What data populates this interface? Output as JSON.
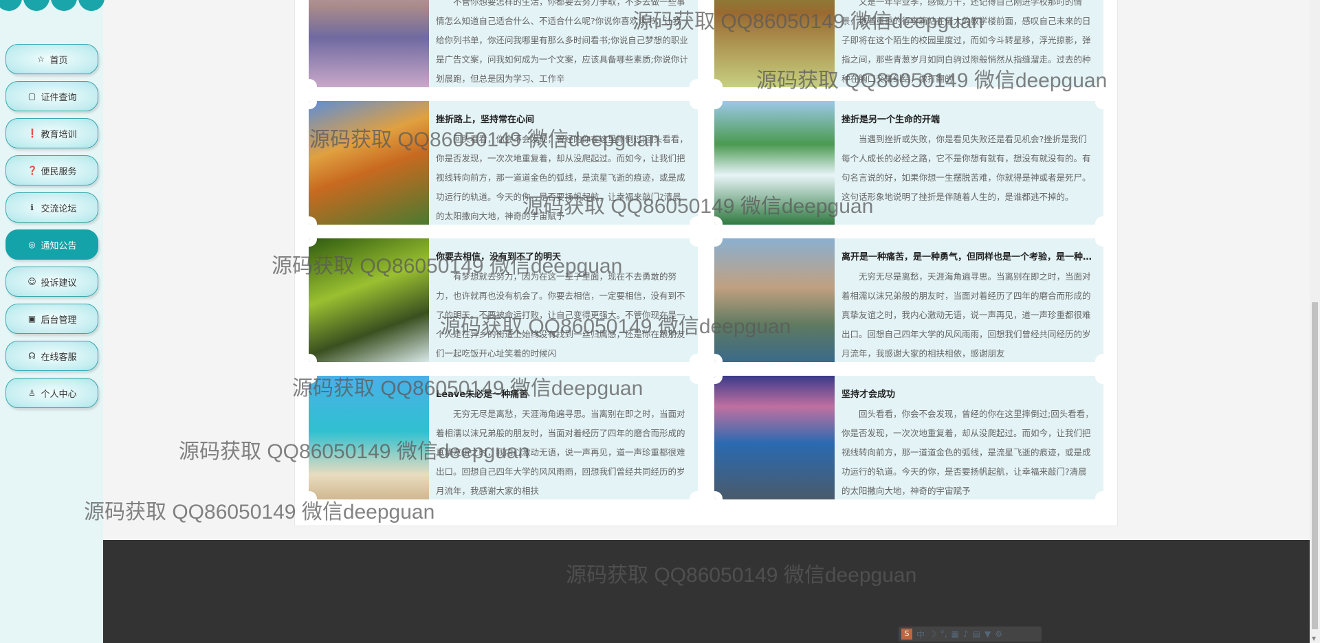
{
  "sidebar": {
    "accent": "#14a3a8",
    "items": [
      {
        "label": "首页",
        "icon": "star-icon",
        "glyph": "☆"
      },
      {
        "label": "证件查询",
        "icon": "bag-icon",
        "glyph": "▢"
      },
      {
        "label": "教育培训",
        "icon": "exclamation-icon",
        "glyph": "❗"
      },
      {
        "label": "便民服务",
        "icon": "question-icon",
        "glyph": "❓"
      },
      {
        "label": "交流论坛",
        "icon": "info-icon",
        "glyph": "ℹ"
      },
      {
        "label": "通知公告",
        "icon": "target-icon",
        "glyph": "◎",
        "active": true
      },
      {
        "label": "投诉建议",
        "icon": "smile-icon",
        "glyph": "☺"
      },
      {
        "label": "后台管理",
        "icon": "briefcase-icon",
        "glyph": "▣"
      },
      {
        "label": "在线客服",
        "icon": "headset-icon",
        "glyph": "☊"
      },
      {
        "label": "个人中心",
        "icon": "user-icon",
        "glyph": "♙"
      }
    ]
  },
  "cards": [
    {
      "title": "",
      "text": "不管你想要怎样的生活，你都要去努力争取，不多去做一些事情怎么知道自己适合什么、不适合什么呢?你说你喜欢读书，让我给你列书单，你还问我哪里有那么多时间看书;你说自己梦想的职业是广告文案，问我如何成为一个文案，应该具备哪些素质;你说你计划晨跑，但总是因为学习、工作辛"
    },
    {
      "title": "",
      "text": "又是一年毕业季，感慨万千，还记得自己刚进学校那时的情景，拖着重重的行李箱站在偌大的教学楼前面，感叹自己未来的日子即将在这个陌生的校园里度过，而如今斗转星移，浮光掠影，弹指之间，那些青葱岁月如同白驹过隙般悄然从指缝溜走。过去的种种在胸口交集纠结，像打翻的"
    },
    {
      "title": "挫折路上，坚持常在心间",
      "text": "回头看看，你会不会发现，曾经的你在这里摔倒过;回头看看，你是否发现，一次次地重复着，却从没爬起过。而如今，让我们把视线转向前方，那一道道金色的弧线，是流星飞逝的痕迹，或是成功运行的轨道。今天的你，是否要扬帆起航，让幸福来敲门?清晨的太阳撒向大地，神奇的宇宙赋予"
    },
    {
      "title": "挫折是另一个生命的开端",
      "text": "当遇到挫折或失败，你是看见失败还是看见机会?挫折是我们每个人成长的必经之路，它不是你想有就有，想没有就没有的。有句名言说的好，如果你想一生摆脱苦难，你就得是神或者是死尸。这句话形象地说明了挫折是伴随着人生的，是谁都逃不掉的。"
    },
    {
      "title": "你要去相信，没有到不了的明天",
      "text": "有梦想就去努力，因为在这一辈子里面，现在不去勇敢的努力，也许就再也没有机会了。你要去相信，一定要相信，没有到不了的明天。不要被命运打败，让自己变得更强大。不管你现在是一个人走在异乡的街道上始终没有找到一丝归属感，还是你在跟朋友们一起吃饭开心址笑着的时候闪"
    },
    {
      "title": "离开是一种痛苦，是一种勇气，但同样也是一个考验，是一种成长",
      "text": "无穷无尽是离愁，天涯海角遍寻思。当离别在即之时，当面对着相濡以沫兄弟般的朋友时，当面对着经历了四年的磨合而形成的真挚友谊之时，我内心激动无语，说一声再见，道一声珍重都很难出口。回想自己四年大学的风风雨雨，回想我们曾经共同经历的岁月流年，我感谢大家的相扶相依，感谢朋友"
    },
    {
      "title": "Leave未必是一种痛苦",
      "text": "无穷无尽是离愁，天涯海角遍寻思。当离别在即之时，当面对着相濡以沫兄弟般的朋友时，当面对着经历了四年的磨合而形成的真挚友谊之时，我内心激动无语，说一声再见，道一声珍重都很难出口。回想自己四年大学的风风雨雨，回想我们曾经共同经历的岁月流年，我感谢大家的相扶"
    },
    {
      "title": "坚持才会成功",
      "text": "回头看看，你会不会发现，曾经的你在这里摔倒过;回头看看，你是否发现，一次次地重复着，却从没爬起过。而如今，让我们把视线转向前方，那一道道金色的弧线，是流星飞逝的痕迹，或是成功运行的轨道。今天的你，是否要扬帆起航，让幸福来敲门?清晨的太阳撒向大地，神奇的宇宙赋予"
    }
  ],
  "watermark": "源码获取 QQ86050149 微信deepguan",
  "ime_toolbar": {
    "mode": "中"
  }
}
